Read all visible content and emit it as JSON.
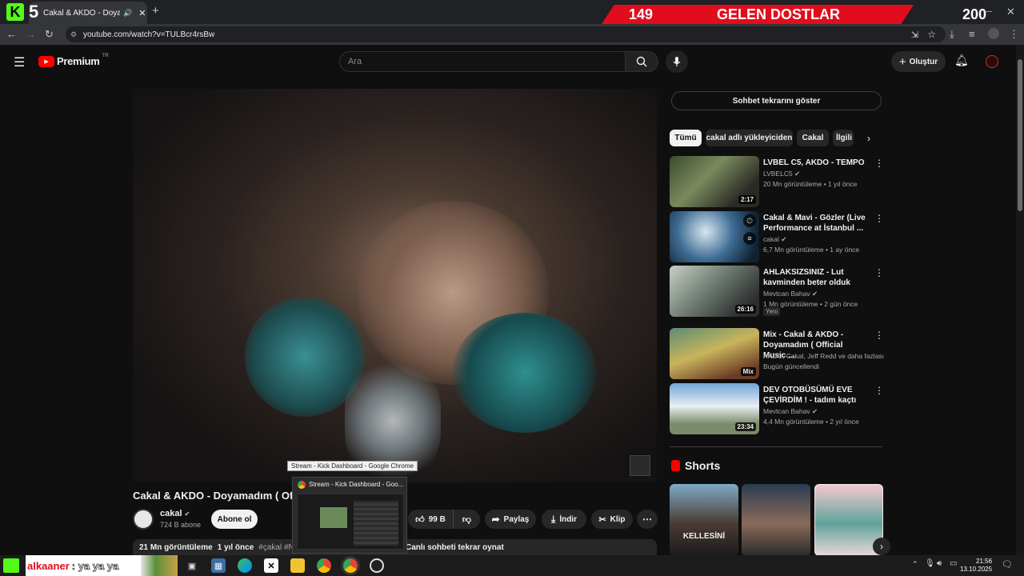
{
  "browser": {
    "tab_title": "Cakal & AKDO - Doyamadım",
    "url": "youtube.com/watch?v=TULBcr4rsBw"
  },
  "stream_overlay": {
    "badge_letter": "K",
    "badge_number": "5",
    "banner_left": "149",
    "banner_text": "GELEN DOSTLAR",
    "banner_right": "200"
  },
  "header": {
    "logo_text": "Premium",
    "region": "TR",
    "search_placeholder": "Ara",
    "create_label": "Oluştur"
  },
  "video": {
    "title": "Cakal & AKDO - Doyamadım ( Offi",
    "channel": "cakal",
    "subscribers": "724 B abone",
    "subscribe_label": "Abone ol",
    "likes": "99 B",
    "share_label": "Paylaş",
    "download_label": "İndir",
    "clip_label": "Klip",
    "views": "21 Mn görüntüleme",
    "age": "1 yıl önce",
    "tags": "#çakal #Ninety",
    "chat_replay": "Canlı sohbeti tekrar oynat"
  },
  "popup": {
    "tooltip": "Stream - Kick Dashboard - Google Chrome",
    "preview_title": "Stream - Kick Dashboard - Goo..."
  },
  "sidebar": {
    "chat_button": "Sohbet tekrarını göster",
    "chips": [
      "Tümü",
      "cakal adlı yükleyiciden",
      "Cakal",
      "İlgili"
    ],
    "recommendations": [
      {
        "title": "LVBEL C5, AKDO - TEMPO",
        "channel": "LVBELC5",
        "meta": "20 Mn görüntüleme • 1 yıl önce",
        "duration": "2:17"
      },
      {
        "title": "Cakal & Mavi - Gözler (Live Performance at İstanbul ...",
        "channel": "cakal",
        "meta": "6,7 Mn görüntüleme • 1 ay önce",
        "duration": ""
      },
      {
        "title": "AHLAKSIZSINIZ - Lut kavminden beter olduk",
        "channel": "Mevtcan Bahav",
        "meta": "1 Mn görüntüleme • 2 gün önce",
        "duration": "26:16",
        "badge": "Yeni"
      },
      {
        "title": "Mix - Cakal & AKDO - Doyamadım ( Official Music ...",
        "channel": "AKDO, Cakal, Jeff Redd ve daha fazlası",
        "meta": "Bugün güncellendi",
        "duration": "Mix"
      },
      {
        "title": "DEV OTOBÜSÜMÜ EVE ÇEVİRDİM ! - tadım kaçtı",
        "channel": "Mevtcan Bahav",
        "meta": "4,4 Mn görüntüleme • 2 yıl önce",
        "duration": "23:34"
      }
    ],
    "shorts_title": "Shorts",
    "shorts": [
      {
        "caption": "KELLESİNİ"
      },
      {
        "caption": ""
      },
      {
        "caption": ""
      }
    ]
  },
  "taskbar": {
    "chat_user": "alkaaner",
    "chat_message": ": ya ya ya",
    "time": "21:56",
    "date": "13.10.2025"
  },
  "colors": {
    "background": "#0f0f0f",
    "yt_red": "#ff0000",
    "banner_red": "#e10d1c",
    "kick_green": "#53fc18"
  }
}
